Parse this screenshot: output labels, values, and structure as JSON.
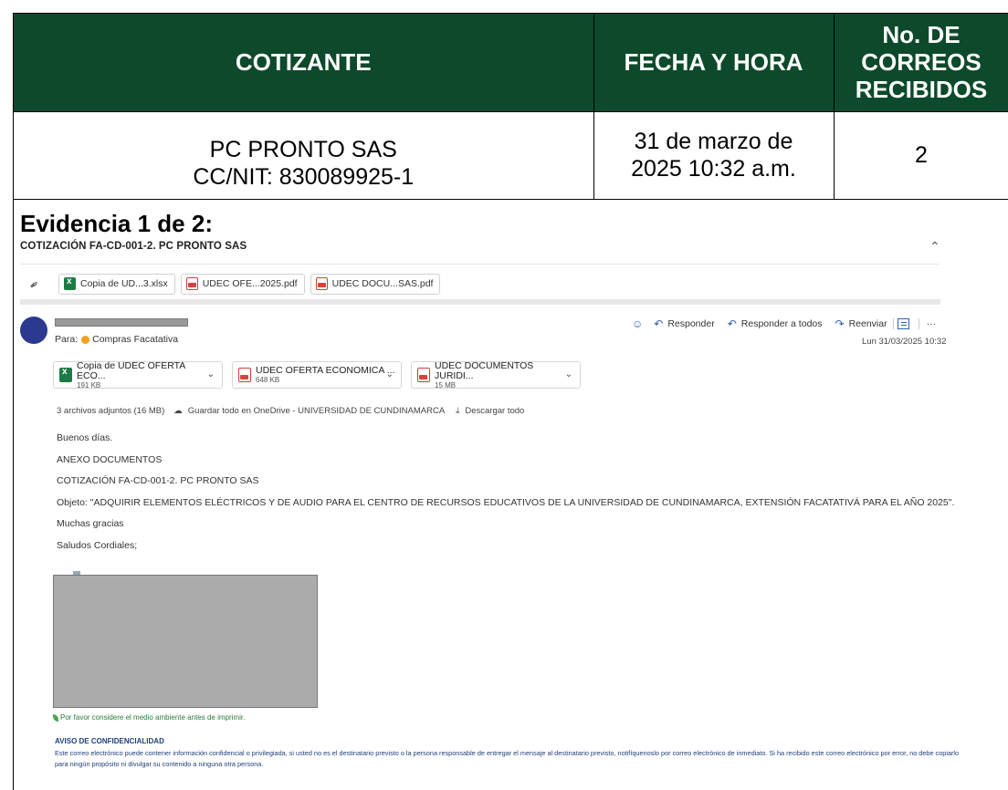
{
  "table": {
    "headers": {
      "cotizante": "COTIZANTE",
      "fecha": "FECHA Y HORA",
      "correos": "No. DE CORREOS RECIBIDOS"
    },
    "row": {
      "cotizante_name": "PC PRONTO SAS",
      "cotizante_nit": "CC/NIT: 830089925-1",
      "fecha": "31 de marzo de 2025 10:32 a.m.",
      "correos": "2"
    },
    "header_bg": "#0d4a2b"
  },
  "evidence_title": "Evidencia 1 de 2:",
  "email": {
    "subject": "COTIZACIÓN FA-CD-001-2. PC PRONTO SAS",
    "collapse_icon": "chevron-up-icon",
    "top_attachments": [
      "Copia de UD...3.xlsx",
      "UDEC OFE...2025.pdf",
      "UDEC DOCU...SAS.pdf"
    ],
    "to_label": "Para:",
    "to_name": "Compras Facatativa",
    "actions": {
      "reply": "Responder",
      "reply_all": "Responder a todos",
      "forward": "Reenviar",
      "more": "···"
    },
    "date": "Lun 31/03/2025 10:32",
    "files": [
      {
        "name": "Copia de UDEC OFERTA ECO...",
        "size": "191 KB",
        "type": "xlsx"
      },
      {
        "name": "UDEC OFERTA ECONOMICA ...",
        "size": "648 KB",
        "type": "pdf"
      },
      {
        "name": "UDEC DOCUMENTOS JURIDI...",
        "size": "15 MB",
        "type": "pdf"
      }
    ],
    "attachments_summary": "3 archivos adjuntos (16 MB)",
    "save_onedrive": "Guardar todo en OneDrive - UNIVERSIDAD DE CUNDINAMARCA",
    "download_all": "Descargar todo",
    "body": [
      "Buenos días.",
      "ANEXO DOCUMENTOS",
      "COTIZACIÓN FA-CD-001-2. PC PRONTO SAS",
      "Objeto: \"ADQUIRIR ELEMENTOS ELÉCTRICOS Y DE AUDIO PARA EL CENTRO DE RECURSOS EDUCATIVOS DE LA UNIVERSIDAD DE CUNDINAMARCA, EXTENSIÓN FACATATIVÁ PARA EL AÑO 2025\".",
      "Muchas gracias",
      "Saludos Cordiales;"
    ],
    "eco_note": "Por favor considere el medio ambiente antes de imprimir.",
    "confidentiality_title": "AVISO DE CONFIDENCIALIDAD",
    "confidentiality_text": "Este correo electrónico puede contener información confidencial o privilegiada, si usted no es el destinatario previsto o la persona responsable de entregar el mensaje al destinatario previsto, notifíquenoslo por correo electrónico de inmediato. Si ha recibido este correo electrónico por error, no debe copiarlo para ningún propósito ni divulgar su contenido a ninguna otra persona."
  }
}
